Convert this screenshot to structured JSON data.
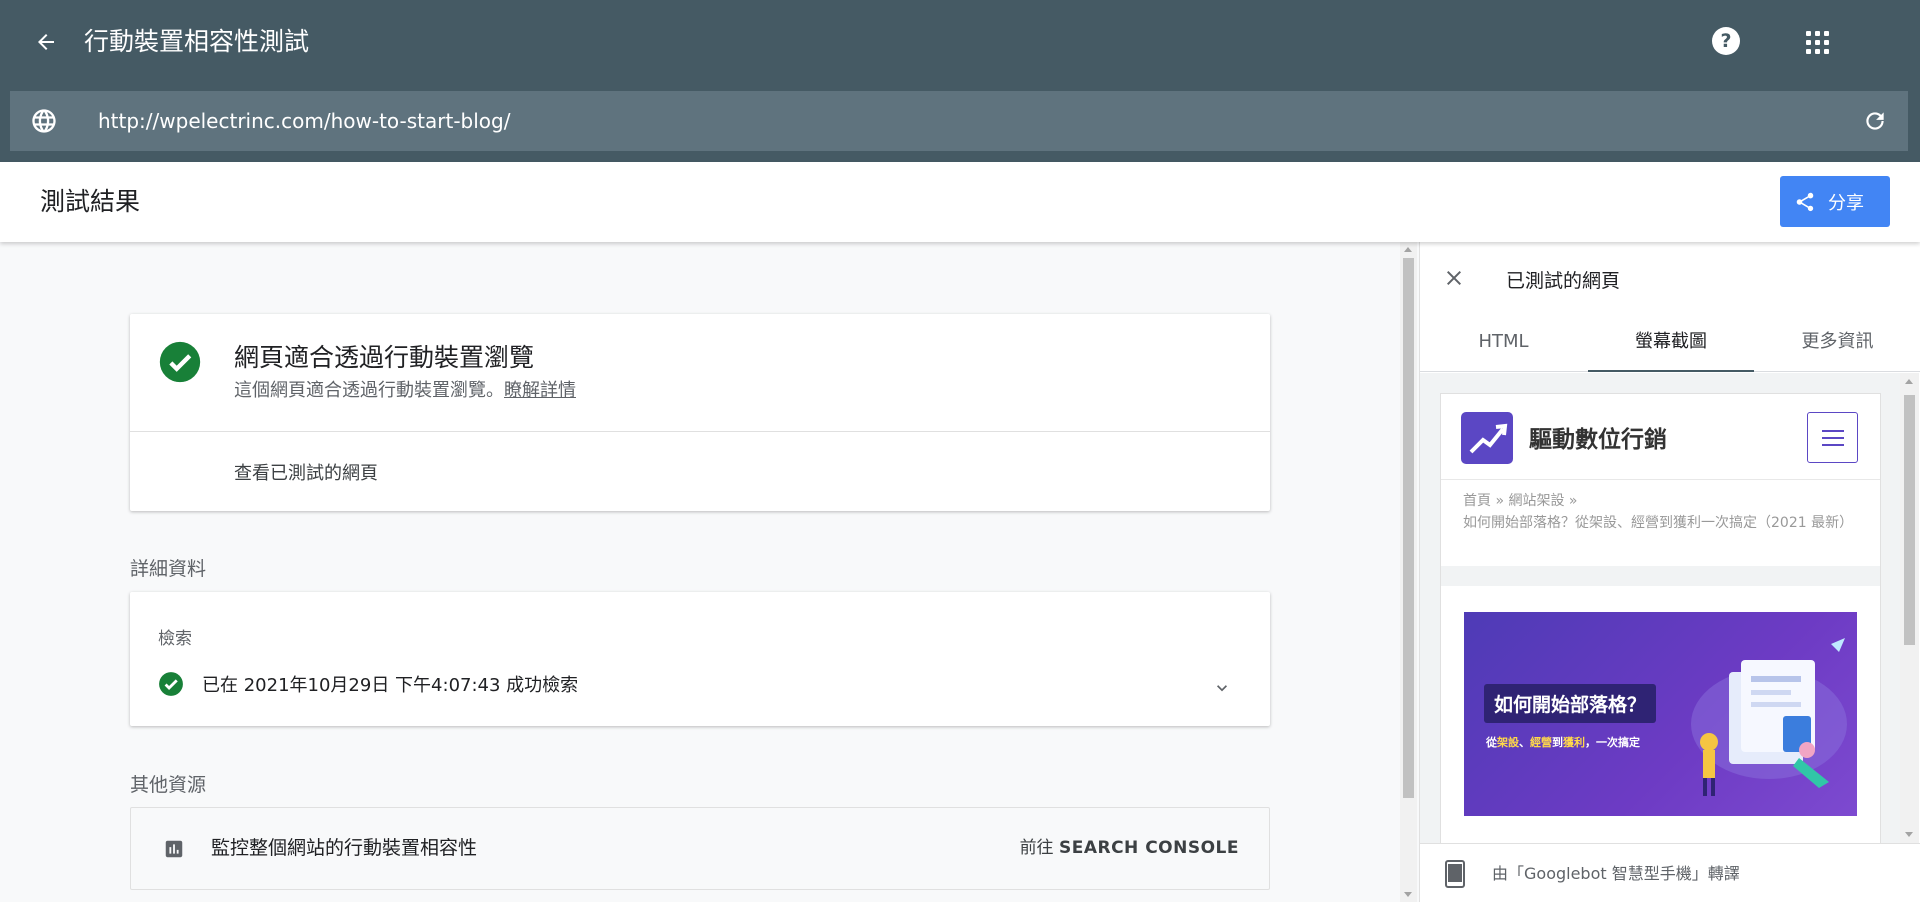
{
  "header": {
    "title": "行動裝置相容性測試",
    "help_label": "?"
  },
  "url_bar": {
    "url": "http://wpelectrinc.com/how-to-start-blog/"
  },
  "results_bar": {
    "title": "測試結果",
    "share_label": "分享"
  },
  "result_card": {
    "heading": "網頁適合透過行動裝置瀏覽",
    "subtext": "這個網頁適合透過行動裝置瀏覽。",
    "learn_more": "瞭解詳情",
    "view_tested": "查看已測試的網頁"
  },
  "details": {
    "section_label": "詳細資料",
    "crawl_label": "檢索",
    "crawl_status": "已在 2021年10月29日 下午4:07:43 成功檢索"
  },
  "other_resources": {
    "section_label": "其他資源",
    "item_label": "監控整個網站的行動裝置相容性",
    "go_prefix": "前往",
    "go_target": "SEARCH CONSOLE"
  },
  "panel": {
    "title": "已測試的網頁",
    "tabs": [
      {
        "label": "HTML"
      },
      {
        "label": "螢幕截圖"
      },
      {
        "label": "更多資訊"
      }
    ],
    "active_tab": "螢幕截圖",
    "footer": "由「Googlebot 智慧型手機」轉譯"
  },
  "screenshot": {
    "site_name": "驅動數位行銷",
    "breadcrumb_line1": "首頁 » 網站架設 »",
    "breadcrumb_line2": "如何開始部落格？從架設、經營到獲利一次搞定（2021 最新）",
    "hero_title": "如何開始部落格？",
    "hero_sub_a": "從",
    "hero_sub_b": "架設",
    "hero_sub_c": "、",
    "hero_sub_d": "經營",
    "hero_sub_e": "到",
    "hero_sub_f": "獲利",
    "hero_sub_g": "，一次搞定"
  },
  "colors": {
    "header_bg": "#455a64",
    "urlbar_bg": "#5f737e",
    "share_bg": "#4285f4",
    "success_green": "#188038"
  },
  "icons": {
    "back": "arrow-left-icon",
    "help": "help-circle-icon",
    "apps": "apps-grid-icon",
    "globe": "globe-icon",
    "reload": "reload-icon",
    "share": "share-icon",
    "check": "check-circle-icon",
    "chevron": "chevron-down-icon",
    "chart": "bar-chart-icon",
    "close": "close-icon",
    "phone": "smartphone-icon"
  }
}
